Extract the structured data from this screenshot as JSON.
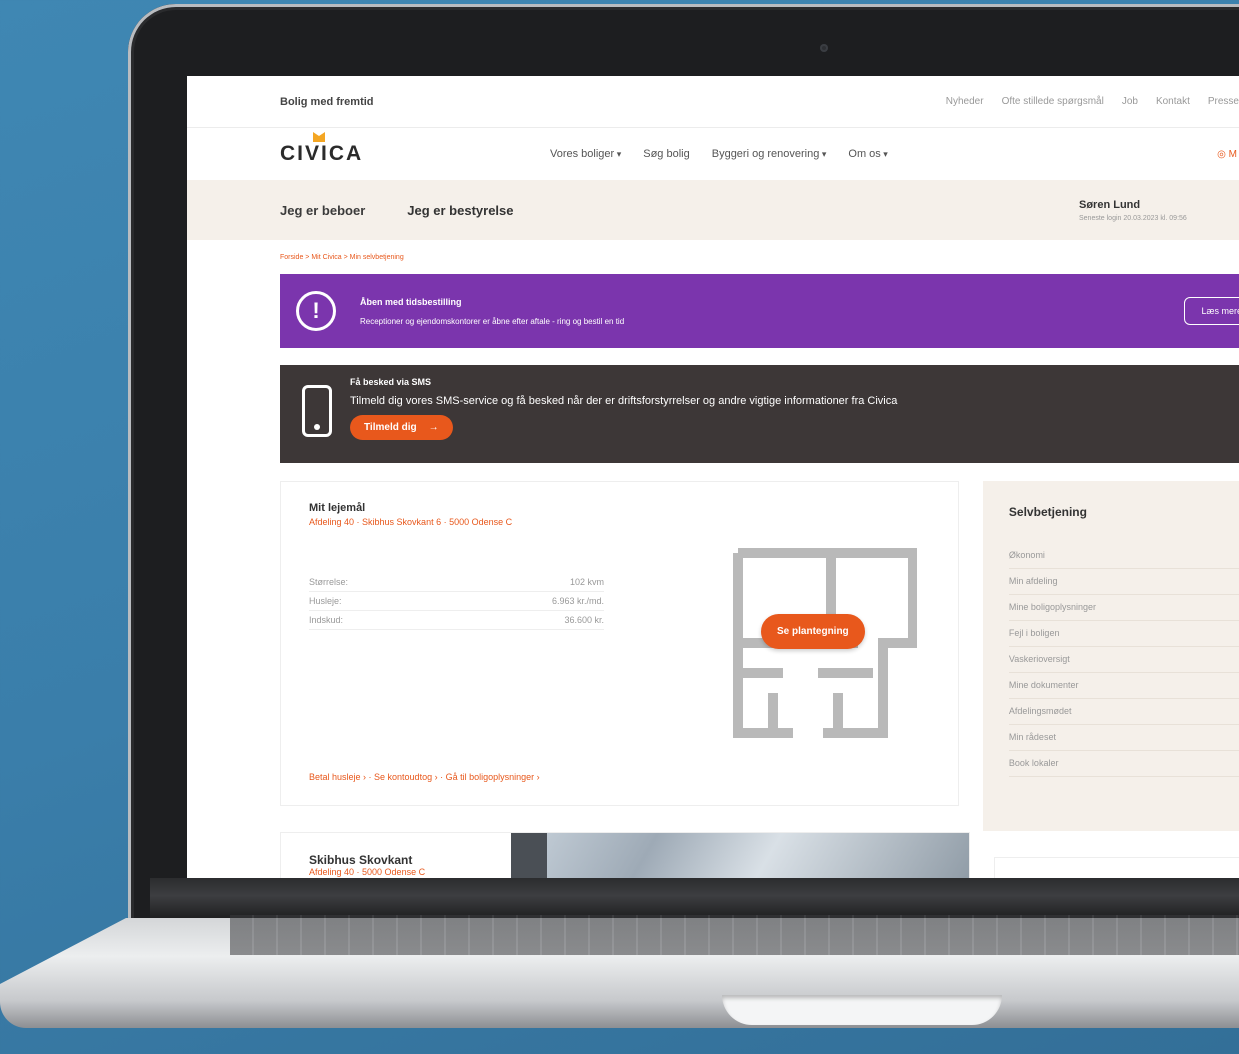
{
  "site": {
    "tagline": "Bolig med fremtid",
    "top_links": [
      "Nyheder",
      "Ofte stillede spørgsmål",
      "Job",
      "Kontakt",
      "Presse"
    ],
    "logo": "CIVICA",
    "menu": [
      "Vores boliger",
      "Søg bolig",
      "Byggeri og renovering",
      "Om os"
    ],
    "login_icon": "user-icon",
    "subnav": {
      "tab1": "Jeg er beboer",
      "tab2": "Jeg er bestyrelse"
    },
    "user": {
      "name": "Søren Lund",
      "last_login": "Seneste login 20.03.2023 kl. 09:56"
    },
    "breadcrumb": "Forside > Mit Civica > Min selvbetjening",
    "alert": {
      "title": "Åben med tidsbestilling",
      "body": "Receptioner og ejendomskontorer er åbne efter aftale - ring og bestil en tid",
      "button": "Læs mere"
    },
    "sms": {
      "title": "Få besked via SMS",
      "body": "Tilmeld dig vores SMS-service og få besked når der er driftsforstyrrelser og andre vigtige informationer fra Civica",
      "button": "Tilmeld dig",
      "button_arrow": "→"
    },
    "lease": {
      "title": "Mit lejemål",
      "subtitle": "Afdeling 40 · Skibhus Skovkant 6 · 5000 Odense C",
      "facts": [
        {
          "label": "Størrelse:",
          "value": "102 kvm"
        },
        {
          "label": "Husleje:",
          "value": "6.963 kr./md."
        },
        {
          "label": "Indskud:",
          "value": "36.600 kr."
        }
      ],
      "plan_button": "Se plantegning",
      "links": "Betal husleje › · Se kontoudtog › · Gå til boligoplysninger ›"
    },
    "selfservice": {
      "title": "Selvbetjening",
      "items": [
        "Økonomi",
        "Min afdeling",
        "Mine boligoplysninger",
        "Fejl i boligen",
        "Vaskerioversigt",
        "Mine dokumenter",
        "Afdelingsmødet",
        "Min rådeset",
        "Book lokaler"
      ]
    },
    "department": {
      "title": "Skibhus Skovkant",
      "subtitle": "Afdeling 40 · 5000 Odense C"
    }
  }
}
